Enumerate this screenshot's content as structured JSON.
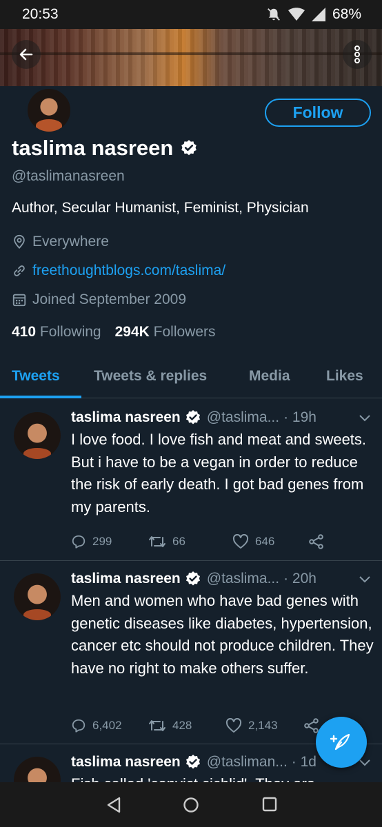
{
  "status_bar": {
    "time": "20:53",
    "battery": "68%"
  },
  "profile": {
    "follow_label": "Follow",
    "name": "taslima nasreen",
    "handle": "@taslimanasreen",
    "bio": "Author, Secular Humanist, Feminist, Physician",
    "location": "Everywhere",
    "website": "freethoughtblogs.com/taslima/",
    "joined": "Joined September 2009",
    "following_count": "410",
    "following_label": "Following",
    "followers_count": "294K",
    "followers_label": "Followers"
  },
  "tabs": [
    {
      "label": "Tweets",
      "active": true
    },
    {
      "label": "Tweets & replies",
      "active": false
    },
    {
      "label": "Media",
      "active": false
    },
    {
      "label": "Likes",
      "active": false
    }
  ],
  "tweets": [
    {
      "name": "taslima nasreen",
      "handle": "@taslima...",
      "time": "· 19h",
      "text": "I love food. I love fish and meat and sweets. But i have to be a  vegan in order to reduce the risk of  early death. I got bad genes from my parents.",
      "replies": "299",
      "retweets": "66",
      "likes": "646"
    },
    {
      "name": "taslima nasreen",
      "handle": "@taslima...",
      "time": "· 20h",
      "text": "Men and women who have bad genes with genetic diseases like diabetes, hypertension, cancer etc should not produce children. They have no right to make others suffer.",
      "replies": "6,402",
      "retweets": "428",
      "likes": "2,143"
    },
    {
      "name": "taslima nasreen",
      "handle": "@tasliman...",
      "time": "· 1d",
      "text": "Fish called 'convict cichlid'. They are",
      "replies": "",
      "retweets": "",
      "likes": ""
    }
  ],
  "colors": {
    "accent": "#1da1f2",
    "background": "#15202b",
    "muted": "#8899a6",
    "divider": "#38444d"
  },
  "icons": [
    "back-arrow-icon",
    "more-vertical-icon",
    "verified-icon",
    "location-icon",
    "link-icon",
    "calendar-icon",
    "reply-icon",
    "retweet-icon",
    "like-icon",
    "share-icon",
    "chevron-down-icon",
    "compose-icon"
  ]
}
